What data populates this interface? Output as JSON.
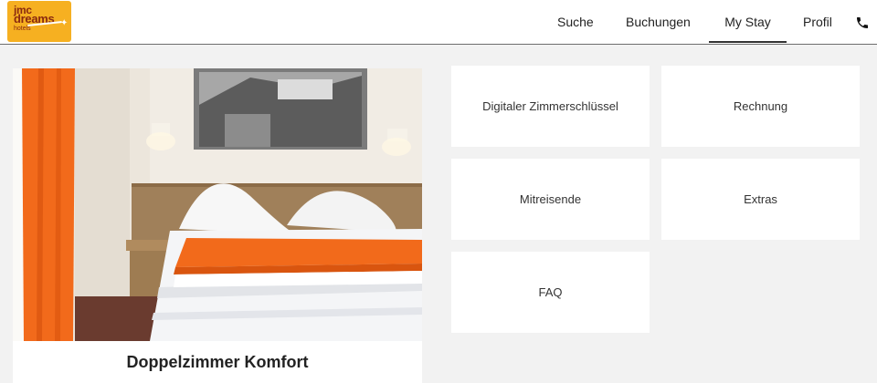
{
  "brand": {
    "logo_line1": "jmc",
    "logo_line2": "dreams",
    "logo_line3": "hotels"
  },
  "nav": {
    "items": [
      {
        "label": "Suche"
      },
      {
        "label": "Buchungen"
      },
      {
        "label": "My Stay",
        "active": true
      },
      {
        "label": "Profil"
      }
    ],
    "phone_icon": "phone-icon"
  },
  "room": {
    "name": "Doppelzimmer Komfort"
  },
  "tiles": [
    {
      "label": "Digitaler Zimmerschlüssel"
    },
    {
      "label": "Rechnung"
    },
    {
      "label": "Mitreisende"
    },
    {
      "label": "Extras"
    },
    {
      "label": "FAQ"
    }
  ],
  "colors": {
    "brand_yellow": "#f6b021",
    "brand_text": "#8a2a10",
    "accent_orange": "#f26a1b",
    "page_bg": "#f2f2f2"
  }
}
